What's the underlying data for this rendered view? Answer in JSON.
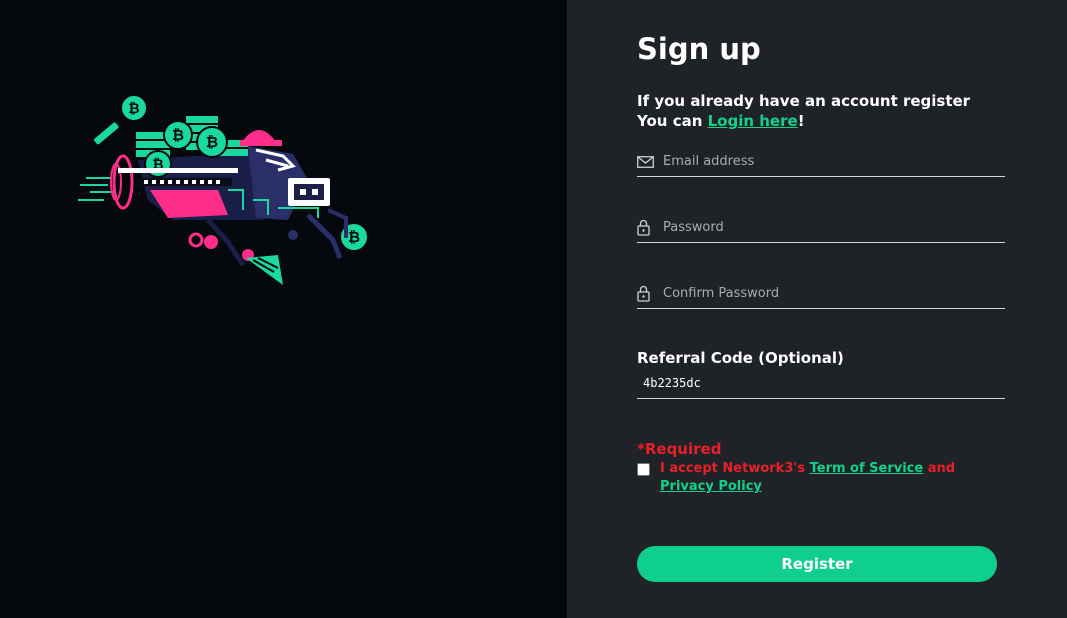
{
  "signup": {
    "title": "Sign up",
    "intro_line1": "If you already have an account register",
    "intro_prefix": "You can ",
    "login_link": "Login here",
    "intro_suffix": "!"
  },
  "fields": {
    "email_placeholder": "Email address",
    "password_placeholder": "Password",
    "confirm_placeholder": "Confirm Password"
  },
  "referral": {
    "label": "Referral Code (Optional)",
    "value": "4b2235dc"
  },
  "terms": {
    "required": "*Required",
    "text_prefix": "I accept Network3's ",
    "tos_link": "Term of Service",
    "and": " and ",
    "privacy_link": "Privacy Policy"
  },
  "actions": {
    "register_label": "Register"
  },
  "colors": {
    "accent": "#0fcf8c",
    "link": "#13d18b",
    "error": "#e8202a",
    "panel": "#1f2226",
    "background": "#05080c",
    "pink": "#ff2d8a"
  },
  "icons": [
    "envelope-icon",
    "lock-icon",
    "bitcoin-icon"
  ]
}
